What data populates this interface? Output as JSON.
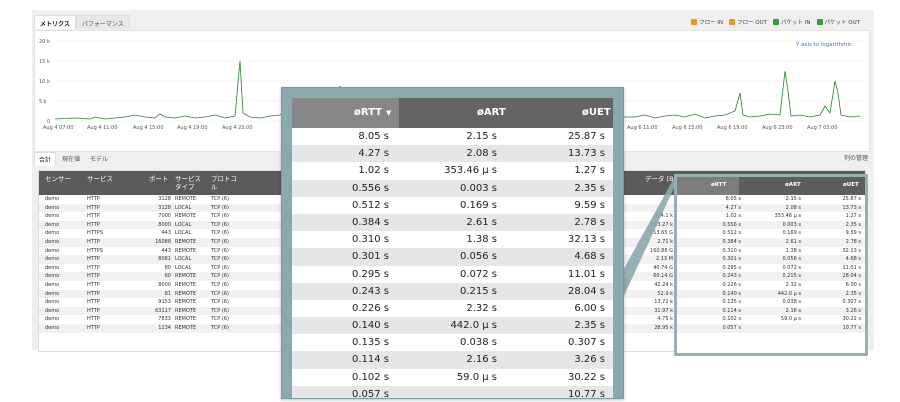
{
  "tabs": {
    "metrics": "メトリクス",
    "performance": "パフォーマンス"
  },
  "legend": [
    {
      "label": "フロー IN",
      "color": "#e8952d"
    },
    {
      "label": "フロー OUT",
      "color": "#e8952d"
    },
    {
      "label": "パケット IN",
      "color": "#3a9a3a"
    },
    {
      "label": "パケット OUT",
      "color": "#3a9a3a"
    }
  ],
  "chart": {
    "yaxis_note": "Y axis to logarithmic",
    "y_ticks": [
      "20 k",
      "15 k",
      "10 k",
      "5 k",
      "0"
    ],
    "x_ticks": [
      "Aug 4 07:00",
      "Aug 4 11:00",
      "Aug 4 15:00",
      "Aug 4 19:00",
      "Aug 4 23:00",
      "Aug 6 11:00",
      "Aug 6 15:00",
      "Aug 6 19:00",
      "Aug 6 23:00",
      "Aug 7 03:00"
    ]
  },
  "subtabs": {
    "total": "合計",
    "current": "現在値",
    "model": "モデル"
  },
  "col_mgmt": "列の管理",
  "table": {
    "headers": {
      "sensor": "センサー",
      "service": "サービス",
      "port": "ポート",
      "svc_type": "サービス\nタイプ",
      "protocol": "プロトコ\nル",
      "data": "データ [B]"
    },
    "rows": [
      [
        "demo",
        "HTTP",
        "3128",
        "REMOTE",
        "TCP (6)",
        ""
      ],
      [
        "demo",
        "HTTP",
        "3128",
        "LOCAL",
        "TCP (6)",
        ""
      ],
      [
        "demo",
        "HTTP",
        "7000",
        "REMOTE",
        "TCP (6)",
        "374.1 k"
      ],
      [
        "demo",
        "HTTP",
        "8000",
        "LOCAL",
        "TCP (6)",
        "593.27 k"
      ],
      [
        "demo",
        "HTTPS",
        "443",
        "LOCAL",
        "TCP (6)",
        "313.65 G"
      ],
      [
        "demo",
        "HTTP",
        "16088",
        "REMOTE",
        "TCP (6)",
        "2.71 k"
      ],
      [
        "demo",
        "HTTPS",
        "443",
        "REMOTE",
        "TCP (6)",
        "160.88 G"
      ],
      [
        "demo",
        "HTTP",
        "8081",
        "LOCAL",
        "TCP (6)",
        "2.13 M"
      ],
      [
        "demo",
        "HTTP",
        "80",
        "LOCAL",
        "TCP (6)",
        "40.74 G"
      ],
      [
        "demo",
        "HTTP",
        "80",
        "REMOTE",
        "TCP (6)",
        "60.14 G"
      ],
      [
        "demo",
        "HTTP",
        "8000",
        "REMOTE",
        "TCP (6)",
        "42.24 k"
      ],
      [
        "demo",
        "HTTP",
        "81",
        "REMOTE",
        "TCP (6)",
        "52.9 k"
      ],
      [
        "demo",
        "HTTP",
        "9153",
        "REMOTE",
        "TCP (6)",
        "13.72 k"
      ],
      [
        "demo",
        "HTTP",
        "63117",
        "REMOTE",
        "TCP (6)",
        "31.97 k"
      ],
      [
        "demo",
        "HTTP",
        "7833",
        "REMOTE",
        "TCP (6)",
        "4.75 k"
      ],
      [
        "demo",
        "HTTP",
        "1234",
        "REMOTE",
        "TCP (6)",
        "28.95 k"
      ]
    ]
  },
  "mini_table": {
    "headers": {
      "rtt": "øRTT",
      "art": "øART",
      "uet": "øUET"
    },
    "rows": [
      [
        "8.05 s",
        "2.15 s",
        "25.87 s"
      ],
      [
        "4.27 s",
        "2.08 s",
        "13.73 s"
      ],
      [
        "1.02 s",
        "353.46 µ s",
        "1.27 s"
      ],
      [
        "0.556 s",
        "0.003 s",
        "2.35 s"
      ],
      [
        "0.512 s",
        "0.169 s",
        "9.59 s"
      ],
      [
        "0.384 s",
        "2.61 s",
        "2.78 s"
      ],
      [
        "0.310 s",
        "1.38 s",
        "32.13 s"
      ],
      [
        "0.301 s",
        "0.056 s",
        "4.68 s"
      ],
      [
        "0.295 s",
        "0.072 s",
        "11.01 s"
      ],
      [
        "0.243 s",
        "0.215 s",
        "28.04 s"
      ],
      [
        "0.226 s",
        "2.32 s",
        "6.00 s"
      ],
      [
        "0.140 s",
        "442.0 µ s",
        "2.35 s"
      ],
      [
        "0.135 s",
        "0.038 s",
        "0.307 s"
      ],
      [
        "0.114 s",
        "2.16 s",
        "3.26 s"
      ],
      [
        "0.102 s",
        "59.0 µ s",
        "30.22 s"
      ],
      [
        "0.057 s",
        "",
        "10.77 s"
      ]
    ]
  },
  "zoom_table": {
    "headers": {
      "rtt": "øRTT",
      "art": "øART",
      "uet": "øUET"
    },
    "rows": [
      [
        "8.05 s",
        "2.15 s",
        "25.87 s"
      ],
      [
        "4.27 s",
        "2.08 s",
        "13.73 s"
      ],
      [
        "1.02 s",
        "353.46 µ s",
        "1.27 s"
      ],
      [
        "0.556 s",
        "0.003 s",
        "2.35 s"
      ],
      [
        "0.512 s",
        "0.169 s",
        "9.59 s"
      ],
      [
        "0.384 s",
        "2.61 s",
        "2.78 s"
      ],
      [
        "0.310 s",
        "1.38 s",
        "32.13 s"
      ],
      [
        "0.301 s",
        "0.056 s",
        "4.68 s"
      ],
      [
        "0.295 s",
        "0.072 s",
        "11.01 s"
      ],
      [
        "0.243 s",
        "0.215 s",
        "28.04 s"
      ],
      [
        "0.226 s",
        "2.32 s",
        "6.00 s"
      ],
      [
        "0.140 s",
        "442.0 µ s",
        "2.35 s"
      ],
      [
        "0.135 s",
        "0.038 s",
        "0.307 s"
      ],
      [
        "0.114 s",
        "2.16 s",
        "3.26 s"
      ],
      [
        "0.102 s",
        "59.0 µ s",
        "30.22 s"
      ],
      [
        "0.057 s",
        "",
        "10.77 s"
      ]
    ]
  }
}
